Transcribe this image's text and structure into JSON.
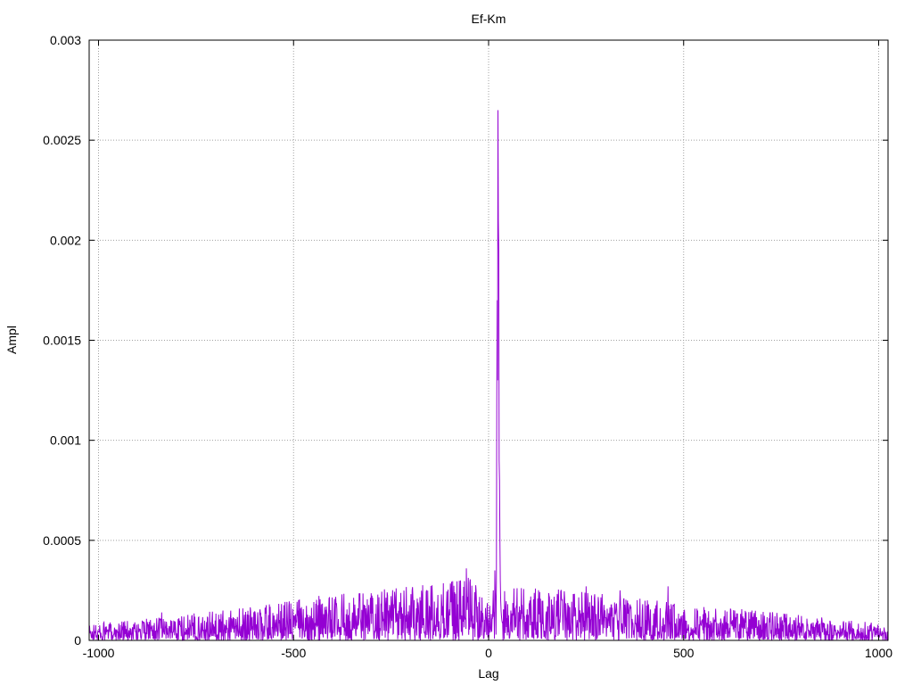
{
  "chart_data": {
    "type": "line",
    "title": "Ef-Km",
    "xlabel": "Lag",
    "ylabel": "Ampl",
    "xlim": [
      -1024,
      1024
    ],
    "ylim": [
      0,
      0.003
    ],
    "grid": true,
    "legend": "none",
    "x_ticks": [
      -1000,
      -500,
      0,
      500,
      1000
    ],
    "x_tick_labels": [
      "-1000",
      "-500",
      "0",
      "500",
      "1000"
    ],
    "y_ticks": [
      0,
      0.0005,
      0.001,
      0.0015,
      0.002,
      0.0025,
      0.003
    ],
    "y_tick_labels": [
      "0",
      "0.0005",
      "0.001",
      "0.0015",
      "0.002",
      "0.0025",
      "0.003"
    ],
    "series": [
      {
        "color": "#9400d3",
        "envelope_x": [
          -1024,
          -900,
          -800,
          -700,
          -600,
          -500,
          -400,
          -300,
          -200,
          -100,
          -50,
          -20,
          0,
          10,
          40,
          100,
          200,
          300,
          400,
          500,
          600,
          700,
          800,
          900,
          1024
        ],
        "envelope_y": [
          4e-05,
          5e-05,
          6e-05,
          7e-05,
          8e-05,
          0.0001,
          0.00011,
          0.00012,
          0.00013,
          0.00014,
          0.00015,
          0.00012,
          9e-05,
          0.00012,
          0.00013,
          0.00013,
          0.00012,
          0.00011,
          0.0001,
          9e-05,
          8e-05,
          7e-05,
          6e-05,
          5e-05,
          4e-05
        ],
        "peaks_x": [
          20,
          21,
          22,
          23,
          24,
          25,
          26,
          27,
          28,
          29,
          30,
          31,
          32,
          33,
          34,
          35,
          -57,
          -838,
          460,
          337,
          250,
          18,
          16,
          12
        ],
        "peaks_y": [
          0.0003,
          0.0012,
          0.0017,
          0.0013,
          0.00265,
          0.0021,
          0.00195,
          0.0009,
          0.0008,
          0.0005,
          0.0003,
          0.0002,
          0.00015,
          0.00012,
          0.0001,
          9e-05,
          0.00036,
          0.00014,
          0.00027,
          0.00025,
          0.00027,
          0.0002,
          0.00035,
          0.00025
        ]
      }
    ]
  }
}
